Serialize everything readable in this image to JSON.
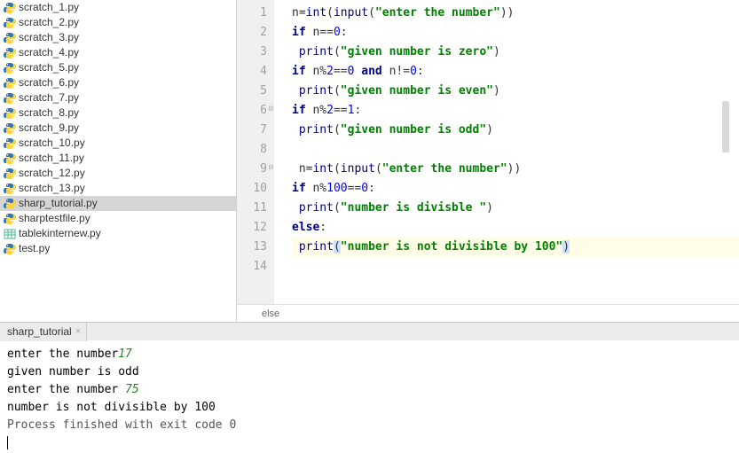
{
  "sidebar": {
    "files": [
      {
        "name": "scratch_1.py",
        "type": "py"
      },
      {
        "name": "scratch_2.py",
        "type": "py"
      },
      {
        "name": "scratch_3.py",
        "type": "py"
      },
      {
        "name": "scratch_4.py",
        "type": "py"
      },
      {
        "name": "scratch_5.py",
        "type": "py"
      },
      {
        "name": "scratch_6.py",
        "type": "py"
      },
      {
        "name": "scratch_7.py",
        "type": "py"
      },
      {
        "name": "scratch_8.py",
        "type": "py"
      },
      {
        "name": "scratch_9.py",
        "type": "py"
      },
      {
        "name": "scratch_10.py",
        "type": "py"
      },
      {
        "name": "scratch_11.py",
        "type": "py"
      },
      {
        "name": "scratch_12.py",
        "type": "py"
      },
      {
        "name": "scratch_13.py",
        "type": "py"
      },
      {
        "name": "sharp_tutorial.py",
        "type": "py",
        "selected": true
      },
      {
        "name": "sharptestfile.py",
        "type": "py"
      },
      {
        "name": "tablekinternew.py",
        "type": "table"
      },
      {
        "name": "test.py",
        "type": "py"
      }
    ]
  },
  "editor": {
    "gutter": [
      "1",
      "2",
      "3",
      "4",
      "5",
      "6",
      "7",
      "8",
      "9",
      "10",
      "11",
      "12",
      "13",
      "14"
    ],
    "lines": {
      "l1": {
        "tok": [
          {
            "t": "n=",
            "c": ""
          },
          {
            "t": "int",
            "c": "bi"
          },
          {
            "t": "(",
            "c": ""
          },
          {
            "t": "input",
            "c": "bi"
          },
          {
            "t": "(",
            "c": ""
          },
          {
            "t": "\"enter the number\"",
            "c": "str"
          },
          {
            "t": "))",
            "c": ""
          }
        ]
      },
      "l2": {
        "tok": [
          {
            "t": "if ",
            "c": "kw"
          },
          {
            "t": "n==",
            "c": ""
          },
          {
            "t": "0",
            "c": "num"
          },
          {
            "t": ":",
            "c": ""
          }
        ]
      },
      "l3": {
        "tok": [
          {
            "t": " ",
            "c": ""
          },
          {
            "t": "print",
            "c": "bi"
          },
          {
            "t": "(",
            "c": ""
          },
          {
            "t": "\"given number is zero\"",
            "c": "str"
          },
          {
            "t": ")",
            "c": ""
          }
        ]
      },
      "l4": {
        "tok": [
          {
            "t": "if ",
            "c": "kw"
          },
          {
            "t": "n%",
            "c": ""
          },
          {
            "t": "2",
            "c": "num"
          },
          {
            "t": "==",
            "c": ""
          },
          {
            "t": "0",
            "c": "num"
          },
          {
            "t": " ",
            "c": ""
          },
          {
            "t": "and ",
            "c": "kw"
          },
          {
            "t": "n!=",
            "c": ""
          },
          {
            "t": "0",
            "c": "num"
          },
          {
            "t": ":",
            "c": ""
          }
        ]
      },
      "l5": {
        "tok": [
          {
            "t": " ",
            "c": ""
          },
          {
            "t": "print",
            "c": "bi"
          },
          {
            "t": "(",
            "c": ""
          },
          {
            "t": "\"given number is even\"",
            "c": "str"
          },
          {
            "t": ")",
            "c": ""
          }
        ]
      },
      "l6": {
        "tok": [
          {
            "t": "if ",
            "c": "kw"
          },
          {
            "t": "n%",
            "c": ""
          },
          {
            "t": "2",
            "c": "num"
          },
          {
            "t": "==",
            "c": ""
          },
          {
            "t": "1",
            "c": "num"
          },
          {
            "t": ":",
            "c": ""
          }
        ]
      },
      "l7": {
        "tok": [
          {
            "t": " ",
            "c": ""
          },
          {
            "t": "print",
            "c": "bi"
          },
          {
            "t": "(",
            "c": ""
          },
          {
            "t": "\"given number is odd\"",
            "c": "str"
          },
          {
            "t": ")",
            "c": ""
          }
        ]
      },
      "l9": {
        "tok": [
          {
            "t": " n=",
            "c": ""
          },
          {
            "t": "int",
            "c": "bi"
          },
          {
            "t": "(",
            "c": ""
          },
          {
            "t": "input",
            "c": "bi"
          },
          {
            "t": "(",
            "c": ""
          },
          {
            "t": "\"enter the number\"",
            "c": "str"
          },
          {
            "t": "))",
            "c": ""
          }
        ]
      },
      "l10": {
        "tok": [
          {
            "t": "if ",
            "c": "kw"
          },
          {
            "t": "n%",
            "c": ""
          },
          {
            "t": "100",
            "c": "num"
          },
          {
            "t": "==",
            "c": ""
          },
          {
            "t": "0",
            "c": "num"
          },
          {
            "t": ":",
            "c": ""
          }
        ]
      },
      "l11": {
        "tok": [
          {
            "t": " ",
            "c": ""
          },
          {
            "t": "print",
            "c": "bi"
          },
          {
            "t": "(",
            "c": ""
          },
          {
            "t": "\"number is divisble \"",
            "c": "str"
          },
          {
            "t": ")",
            "c": ""
          }
        ]
      },
      "l12": {
        "tok": [
          {
            "t": "else",
            "c": "kw"
          },
          {
            "t": ":",
            "c": ""
          }
        ]
      },
      "l13": {
        "tok": [
          {
            "t": " ",
            "c": ""
          },
          {
            "t": "print",
            "c": "bi"
          },
          {
            "t": "(",
            "c": "sel"
          },
          {
            "t": "\"number is not divisible by 100\"",
            "c": "str"
          },
          {
            "t": ")",
            "c": "sel"
          }
        ]
      }
    },
    "breadcrumb": "else"
  },
  "tab": {
    "label": "sharp_tutorial"
  },
  "console": {
    "l1a": "enter the number",
    "l1b": "17",
    "l2": "given number is odd",
    "l3a": "enter the number ",
    "l3b": "75",
    "l4": "number is not divisible by 100",
    "l5": "",
    "l6": "Process finished with exit code 0"
  }
}
